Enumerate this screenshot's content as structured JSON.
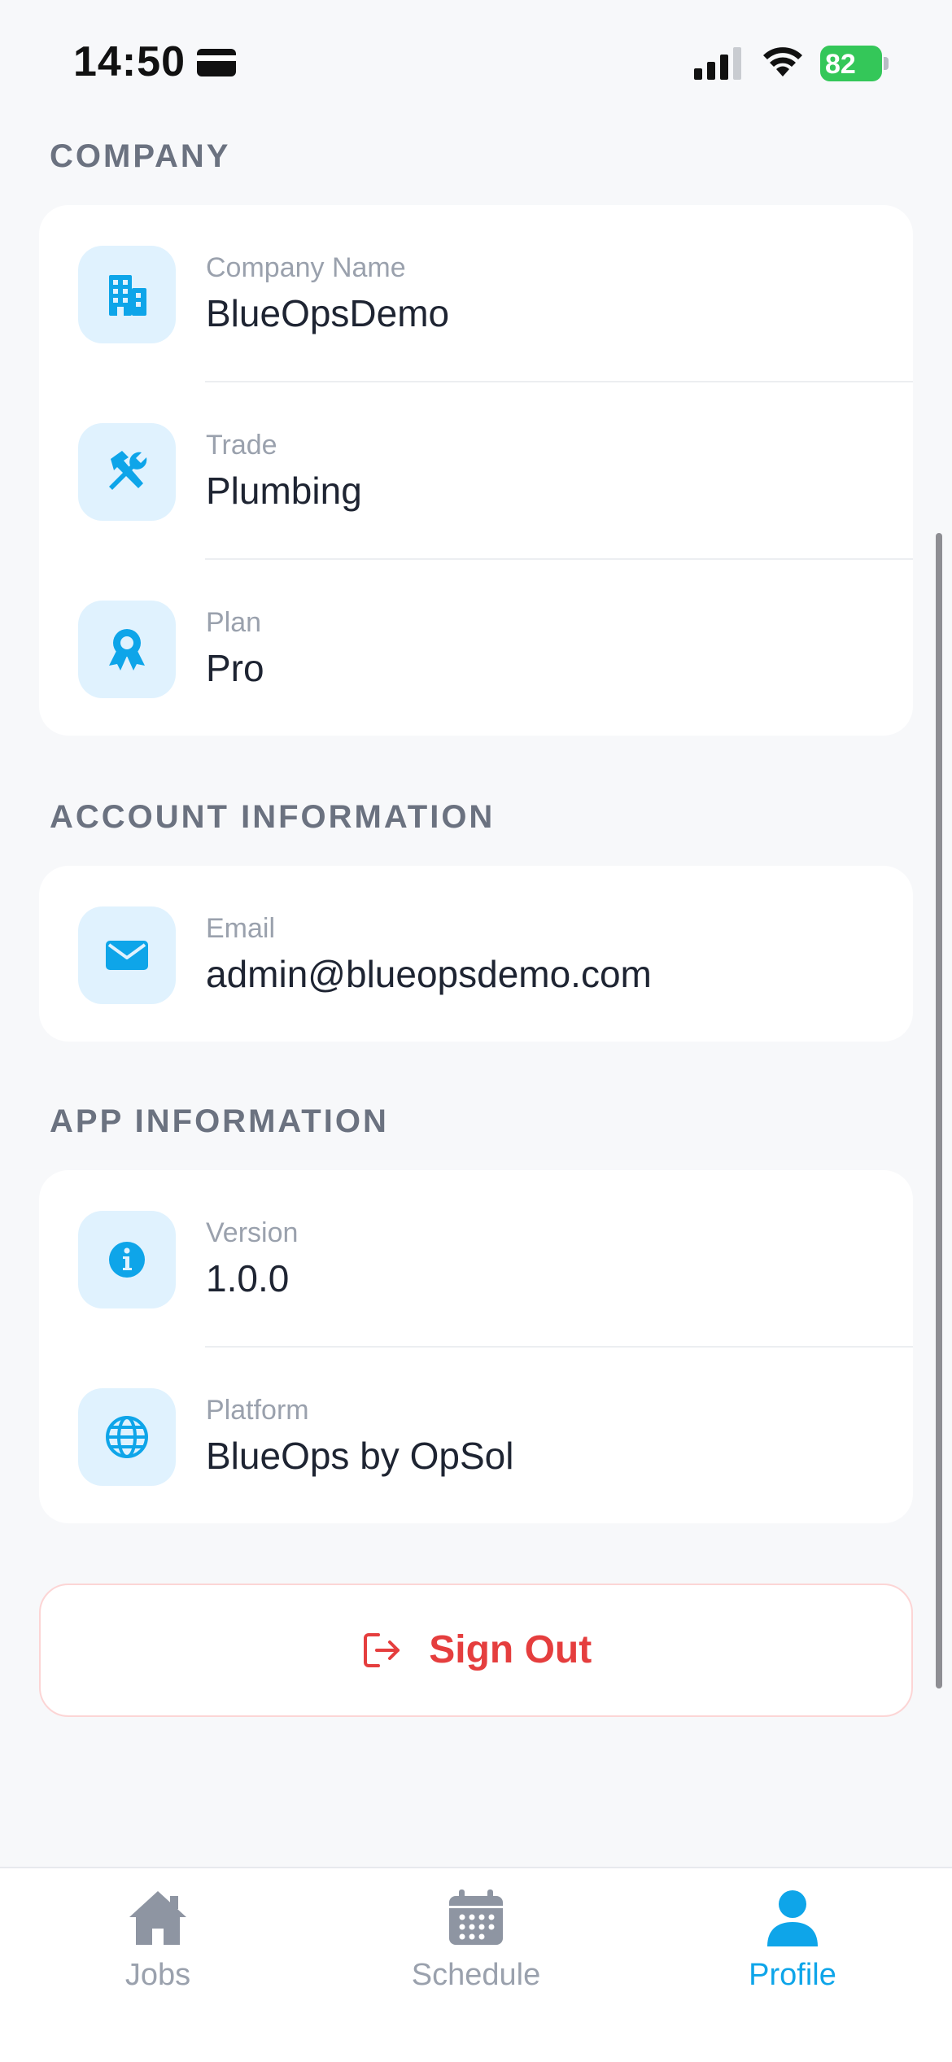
{
  "status_bar": {
    "time": "14:50",
    "battery": "82"
  },
  "sections": {
    "company": {
      "title": "COMPANY",
      "rows": [
        {
          "label": "Company Name",
          "value": "BlueOpsDemo",
          "icon": "building-icon"
        },
        {
          "label": "Trade",
          "value": "Plumbing",
          "icon": "tools-icon"
        },
        {
          "label": "Plan",
          "value": "Pro",
          "icon": "award-icon"
        }
      ]
    },
    "account": {
      "title": "ACCOUNT INFORMATION",
      "rows": [
        {
          "label": "Email",
          "value": "admin@blueopsdemo.com",
          "icon": "mail-icon"
        }
      ]
    },
    "app": {
      "title": "APP INFORMATION",
      "rows": [
        {
          "label": "Version",
          "value": "1.0.0",
          "icon": "info-icon"
        },
        {
          "label": "Platform",
          "value": "BlueOps by OpSol",
          "icon": "globe-icon"
        }
      ]
    }
  },
  "sign_out": {
    "label": "Sign Out"
  },
  "tabs": [
    {
      "label": "Jobs",
      "icon": "home-icon",
      "active": false
    },
    {
      "label": "Schedule",
      "icon": "calendar-icon",
      "active": false
    },
    {
      "label": "Profile",
      "icon": "person-icon",
      "active": true
    }
  ],
  "colors": {
    "accent": "#0ea5e9",
    "icon_bg": "#e0f2fe",
    "danger": "#e53e3e",
    "background": "#f7f8fa",
    "battery": "#34c759"
  }
}
